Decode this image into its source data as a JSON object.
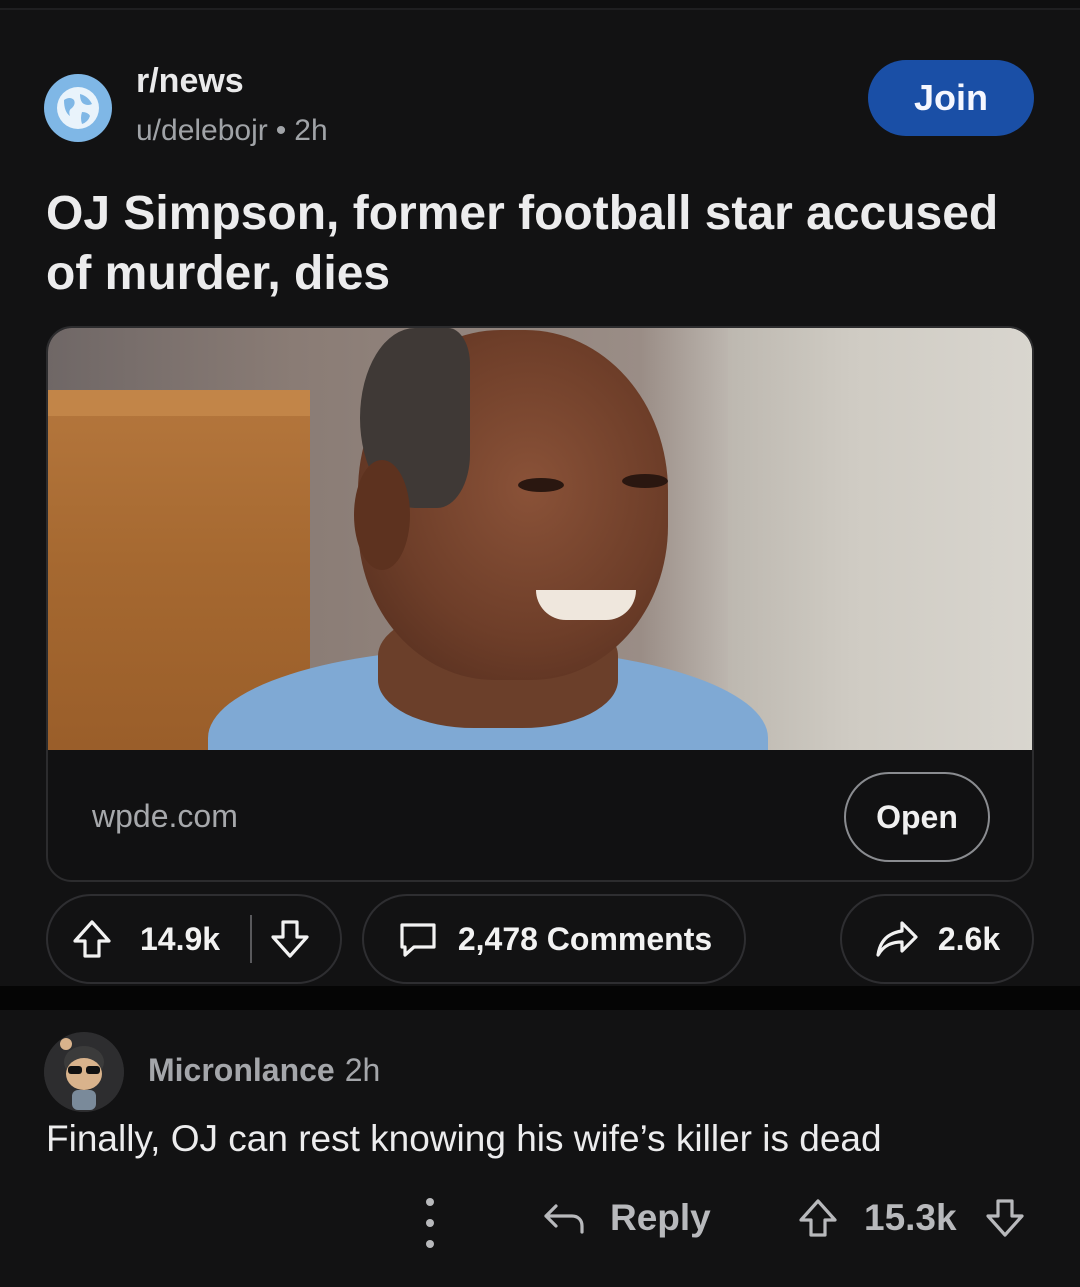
{
  "post": {
    "subreddit": "r/news",
    "author": "u/delebojr",
    "separator": "•",
    "age": "2h",
    "join_label": "Join",
    "title": "OJ Simpson, former football star accused of murder, dies",
    "link": {
      "domain": "wpde.com",
      "open_label": "Open"
    },
    "actions": {
      "upvotes": "14.9k",
      "comments": "2,478 Comments",
      "shares": "2.6k"
    }
  },
  "comment": {
    "author": "Micronlance",
    "age": "2h",
    "text": "Finally, OJ can rest knowing his wife’s killer is dead",
    "reply_label": "Reply",
    "votes": "15.3k"
  },
  "colors": {
    "background": "#121213",
    "join_button": "#1a4fa6",
    "sub_avatar": "#7fb7e6"
  },
  "icons": [
    "globe-icon",
    "upvote-icon",
    "downvote-icon",
    "comment-icon",
    "share-icon",
    "more-icon",
    "reply-icon"
  ]
}
